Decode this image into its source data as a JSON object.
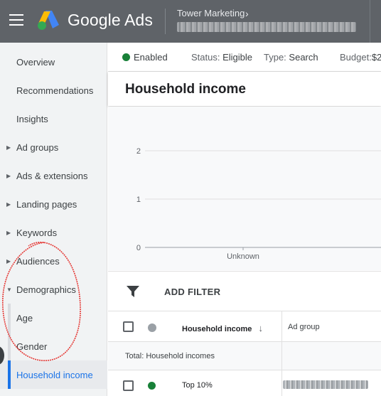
{
  "header": {
    "product_name": "Google Ads",
    "account_name": "Tower Marketing",
    "account_chevron": "›"
  },
  "sidebar": {
    "items": [
      {
        "label": "Overview"
      },
      {
        "label": "Recommendations"
      },
      {
        "label": "Insights"
      },
      {
        "label": "Ad groups"
      },
      {
        "label": "Ads & extensions"
      },
      {
        "label": "Landing pages"
      },
      {
        "label": "Keywords"
      },
      {
        "label": "Audiences"
      },
      {
        "label": "Demographics"
      },
      {
        "label": "Age"
      },
      {
        "label": "Gender"
      },
      {
        "label": "Household income"
      }
    ],
    "active_item": "Household income"
  },
  "status_strip": {
    "enabled": "Enabled",
    "status_label": "Status:",
    "status_value": "Eligible",
    "type_label": "Type:",
    "type_value": "Search",
    "budget_label": "Budget:",
    "budget_value": "$2"
  },
  "page": {
    "title": "Household income"
  },
  "chart_data": {
    "type": "bar",
    "categories": [
      "Unknown"
    ],
    "values": [
      0
    ],
    "y_ticks": [
      "0",
      "1",
      "2"
    ],
    "ylim": [
      0,
      2
    ],
    "grid": true
  },
  "filter": {
    "label": "ADD FILTER"
  },
  "table": {
    "columns": [
      "Household income",
      "Ad group"
    ],
    "sort_indicator": "↓",
    "total_label": "Total: Household incomes",
    "rows": [
      {
        "income": "Top 10%",
        "status_color": "#188038"
      }
    ]
  },
  "colors": {
    "topbar": "#5f6368",
    "accent": "#1a73e8",
    "enabled_green": "#188038",
    "annotation_red": "#e53935"
  }
}
